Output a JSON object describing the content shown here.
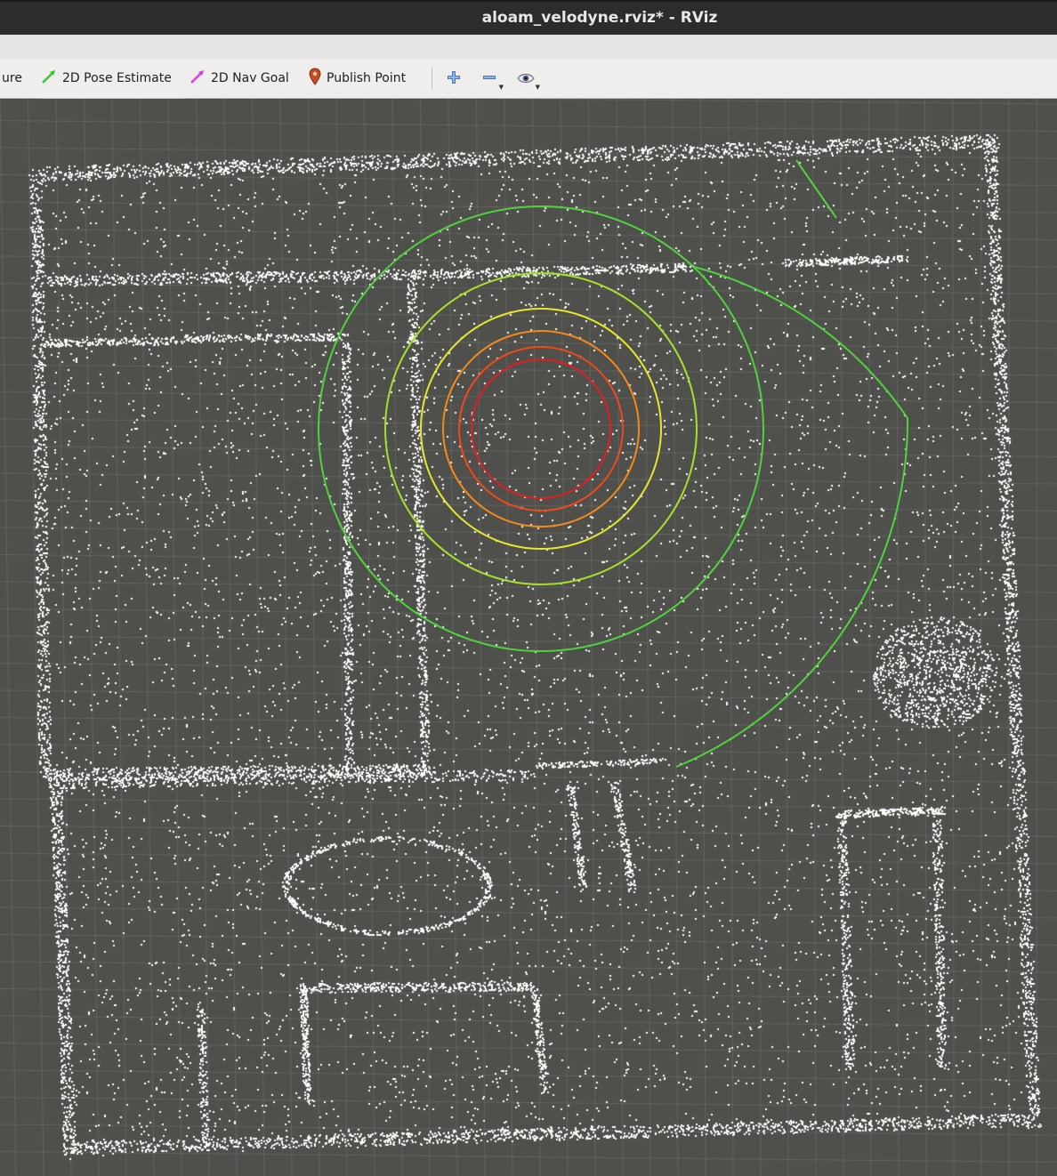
{
  "window": {
    "title": "aloam_velodyne.rviz* - RViz"
  },
  "toolbar": {
    "tools": [
      {
        "id": "partial",
        "label": "ure",
        "icon": "partial-tool-icon"
      },
      {
        "id": "pose",
        "label": "2D Pose Estimate",
        "icon": "green-arrow-icon",
        "color": "#2ecc2e"
      },
      {
        "id": "nav",
        "label": "2D Nav Goal",
        "icon": "magenta-arrow-icon",
        "color": "#e03ce0"
      },
      {
        "id": "point",
        "label": "Publish Point",
        "icon": "map-pin-icon",
        "color": "#d2552a"
      }
    ],
    "view_icons": [
      "plus-icon",
      "minus-icon",
      "eye-icon"
    ]
  },
  "viewport": {
    "background": "#4f4f4c",
    "grid_color": "#8a8a88",
    "point_color": "#ffffff",
    "ring_colors": [
      "#e02020",
      "#f04a18",
      "#f58a1a",
      "#e8e82a",
      "#a6e02a",
      "#4fd23c"
    ]
  }
}
